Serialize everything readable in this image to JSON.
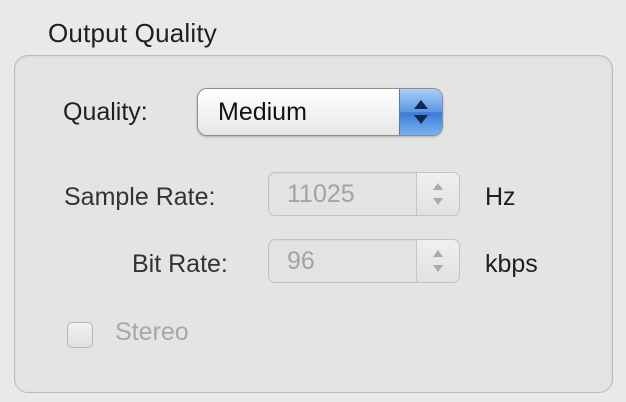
{
  "group": {
    "title": "Output Quality"
  },
  "quality": {
    "label": "Quality:",
    "value": "Medium"
  },
  "sample_rate": {
    "label": "Sample Rate:",
    "value": "11025",
    "unit": "Hz"
  },
  "bit_rate": {
    "label": "Bit Rate:",
    "value": "96",
    "unit": "kbps"
  },
  "stereo": {
    "label": "Stereo",
    "checked": false
  },
  "colors": {
    "accent_blue": "#4a86dc",
    "disabled_text": "#a3a3a3"
  },
  "icons": {
    "popup_arrows": "up-down-arrows",
    "stepper": "stepper-arrows"
  }
}
